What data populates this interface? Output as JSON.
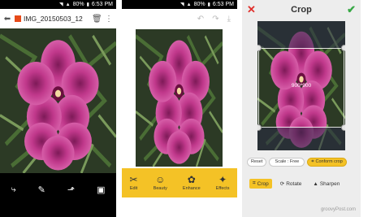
{
  "screen1": {
    "status": {
      "battery": "80%",
      "time": "6:53 PM"
    },
    "appbar": {
      "back_icon": "back-arrow-icon",
      "filename": "IMG_20150503_12",
      "delete_icon": "trash-icon",
      "menu_icon": "overflow-menu-icon"
    },
    "bottom_actions": [
      "share-icon",
      "edit-icon",
      "open-with-icon",
      "info-icon"
    ]
  },
  "screen2": {
    "status": {
      "battery": "80%",
      "time": "6:53 PM"
    },
    "toolbar_icons": [
      "undo-icon",
      "redo-icon",
      "save-icon"
    ],
    "tools": [
      {
        "icon": "scissors-icon",
        "label": "Edit"
      },
      {
        "icon": "smiley-icon",
        "label": "Beauty"
      },
      {
        "icon": "palette-icon",
        "label": "Enhance"
      },
      {
        "icon": "sparkle-icon",
        "label": "Effects"
      }
    ]
  },
  "screen3": {
    "header": {
      "cancel_icon": "close-icon",
      "title": "Crop",
      "confirm_icon": "check-icon"
    },
    "crop_size": "900*900",
    "controls": {
      "reset": "Reset",
      "scale": "Scale : Free",
      "confirm": "Conform crop"
    },
    "tabs": [
      {
        "icon": "crop-icon",
        "label": "Crop",
        "active": true
      },
      {
        "icon": "rotate-icon",
        "label": "Rotate",
        "active": false
      },
      {
        "icon": "sharpen-icon",
        "label": "Sharpen",
        "active": false
      }
    ]
  },
  "watermark": "groovyPost.com",
  "colors": {
    "accent_yellow": "#f4c226",
    "cancel_red": "#e0302c",
    "confirm_green": "#37a845",
    "flower_pink": "#c8378f"
  }
}
